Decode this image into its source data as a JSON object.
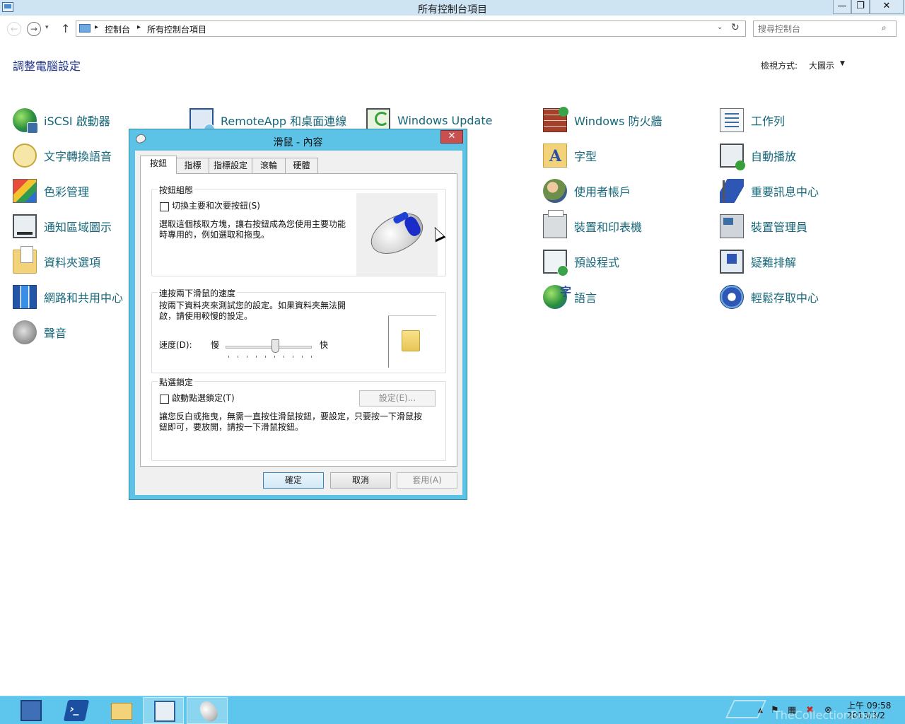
{
  "window": {
    "title": "所有控制台項目",
    "min_glyph": "—",
    "max_glyph": "❐",
    "close_glyph": "✕"
  },
  "nav": {
    "back_glyph": "←",
    "forward_glyph": "→",
    "history_glyph": "▾",
    "up_glyph": "↑",
    "breadcrumb": [
      "控制台",
      "所有控制台項目"
    ],
    "crumb_sep": "▸",
    "dropdown_glyph": "⌄",
    "refresh_glyph": "↻",
    "search_placeholder": "搜尋控制台",
    "search_glyph": "⌕"
  },
  "main": {
    "title": "調整電腦設定",
    "view_by_label": "檢視方式:",
    "view_by_value": "大圖示",
    "view_by_arrow": "▼",
    "items": [
      {
        "label": "iSCSI 啟動器",
        "icon": "globe-shield-icon"
      },
      {
        "label": "文字轉換語音",
        "icon": "speech-bubble-icon"
      },
      {
        "label": "色彩管理",
        "icon": "color-palette-icon"
      },
      {
        "label": "通知區域圖示",
        "icon": "notification-monitor-icon"
      },
      {
        "label": "資料夾選項",
        "icon": "folder-options-icon"
      },
      {
        "label": "網路和共用中心",
        "icon": "network-icon"
      },
      {
        "label": "聲音",
        "icon": "speaker-icon"
      },
      {
        "label": "RemoteApp 和桌面連線",
        "icon": "remote-desktop-icon"
      },
      {
        "label": "Windows Update",
        "icon": "windows-update-icon"
      },
      {
        "label": "Windows 防火牆",
        "icon": "firewall-icon"
      },
      {
        "label": "字型",
        "icon": "font-icon"
      },
      {
        "label": "使用者帳戶",
        "icon": "users-icon"
      },
      {
        "label": "裝置和印表機",
        "icon": "printer-icon"
      },
      {
        "label": "預設程式",
        "icon": "default-programs-icon"
      },
      {
        "label": "語言",
        "icon": "language-icon"
      },
      {
        "label": "工作列",
        "icon": "taskbar-icon"
      },
      {
        "label": "自動播放",
        "icon": "autoplay-icon"
      },
      {
        "label": "重要訊息中心",
        "icon": "action-center-flag-icon"
      },
      {
        "label": "裝置管理員",
        "icon": "device-manager-icon"
      },
      {
        "label": "疑難排解",
        "icon": "troubleshooting-icon"
      },
      {
        "label": "輕鬆存取中心",
        "icon": "ease-of-access-icon"
      }
    ]
  },
  "dialog": {
    "title": "滑鼠 - 內容",
    "close_glyph": "✕",
    "tabs": [
      "按鈕",
      "指標",
      "指標設定",
      "滾輪",
      "硬體"
    ],
    "active_tab": 0,
    "button_config": {
      "group_title": "按鈕組態",
      "checkbox_label": "切換主要和次要按鈕(S)",
      "checked": false,
      "desc_line1": "選取這個核取方塊，讓右按鈕成為您使用主要功能",
      "desc_line2": "時專用的，例如選取和拖曳。"
    },
    "double_click": {
      "group_title": "連按兩下滑鼠的速度",
      "desc_line1": "按兩下資料夾來測試您的設定。如果資料夾無法開",
      "desc_line2": "啟，請使用較慢的設定。",
      "speed_label": "速度(D):",
      "slow_label": "慢",
      "fast_label": "快",
      "speed_value": 0.58
    },
    "click_lock": {
      "group_title": "點選鎖定",
      "checkbox_label": "啟動點選鎖定(T)",
      "checked": false,
      "settings_button": "設定(E)...",
      "desc_line1": "讓您反白或拖曳，無需一直按住滑鼠按鈕，要設定，只要按一下滑鼠按",
      "desc_line2": "鈕即可，要放開，請按一下滑鼠按鈕。"
    },
    "ok_button": "確定",
    "cancel_button": "取消",
    "apply_button": "套用(A)"
  },
  "taskbar": {
    "items": [
      "server-manager-icon",
      "powershell-icon",
      "file-explorer-icon",
      "control-panel-icon",
      "mouse-icon"
    ],
    "active_item": 4,
    "tray": {
      "overflow_glyph": "▲",
      "flag_glyph": "⚑",
      "network_glyph": "▦",
      "volume_glyph": "✖",
      "other_glyph": "⊗"
    },
    "clock_time": "上午 09:58",
    "clock_date": "2013/3/2",
    "watermark": "TheCollectionBook"
  }
}
